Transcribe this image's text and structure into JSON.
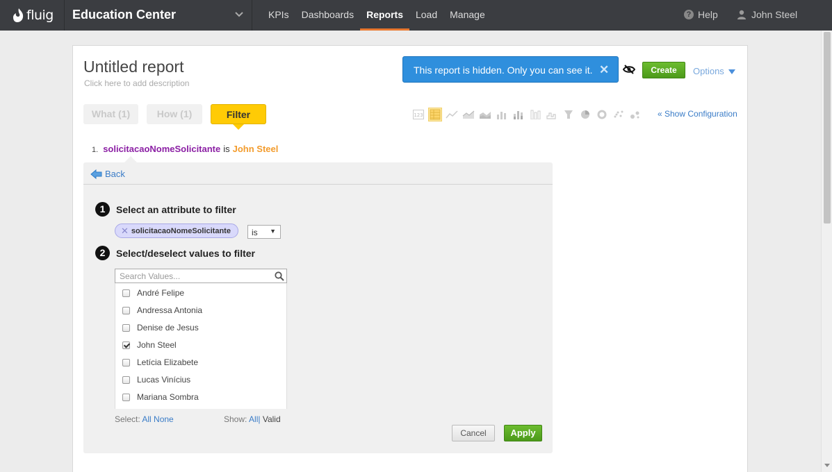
{
  "header": {
    "logo_text": "fluig",
    "app_name": "Education Center",
    "nav": [
      {
        "label": "KPIs",
        "active": false
      },
      {
        "label": "Dashboards",
        "active": false
      },
      {
        "label": "Reports",
        "active": true
      },
      {
        "label": "Load",
        "active": false
      },
      {
        "label": "Manage",
        "active": false
      }
    ],
    "help_label": "Help",
    "user_name": "John Steel"
  },
  "report": {
    "title": "Untitled report",
    "description_placeholder": "Click here to add description",
    "hidden_notice": "This report is hidden. Only you can see it.",
    "hidden_close": "✕",
    "create_label": "Create",
    "options_label": "Options",
    "show_config_label": "« Show Configuration"
  },
  "tabs": {
    "what": "What (1)",
    "how": "How (1)",
    "filter": "Filter"
  },
  "viz_types": [
    "number",
    "table",
    "line",
    "area-line",
    "area",
    "bar",
    "stacked-bar",
    "column",
    "stacked-column",
    "funnel",
    "pie",
    "donut",
    "scatter",
    "bubble"
  ],
  "filter_summary": {
    "number": "1.",
    "attribute": "solicitacaoNomeSolicitante",
    "operator": "is",
    "value": "John Steel"
  },
  "filter_panel": {
    "back_label": "Back",
    "step1_num": "1",
    "step1_label": "Select an attribute to filter",
    "attribute_chip": "solicitacaoNomeSolicitante",
    "operator_value": "is",
    "step2_num": "2",
    "step2_label": "Select/deselect values to filter",
    "search_placeholder": "Search Values...",
    "values": [
      {
        "label": "André Felipe",
        "checked": false
      },
      {
        "label": "Andressa Antonia",
        "checked": false
      },
      {
        "label": "Denise de Jesus",
        "checked": false
      },
      {
        "label": "John Steel",
        "checked": true
      },
      {
        "label": "Letícia Elizabete",
        "checked": false
      },
      {
        "label": "Lucas Vinícius",
        "checked": false
      },
      {
        "label": "Mariana Sombra",
        "checked": false
      }
    ],
    "select_label": "Select:",
    "select_all": "All",
    "select_none": "None",
    "show_label": "Show:",
    "show_all": "All",
    "show_sep": "|",
    "show_valid": "Valid",
    "cancel_label": "Cancel",
    "apply_label": "Apply"
  },
  "colors": {
    "topbar": "#3b3d41",
    "accent_orange": "#e8772e",
    "notice_blue": "#2f8fdd",
    "create_green": "#5aa824",
    "filter_yellow": "#ffcb05",
    "attribute_purple": "#8b1fa4",
    "value_orange": "#f39c2d",
    "link_blue": "#3a7cc7"
  }
}
